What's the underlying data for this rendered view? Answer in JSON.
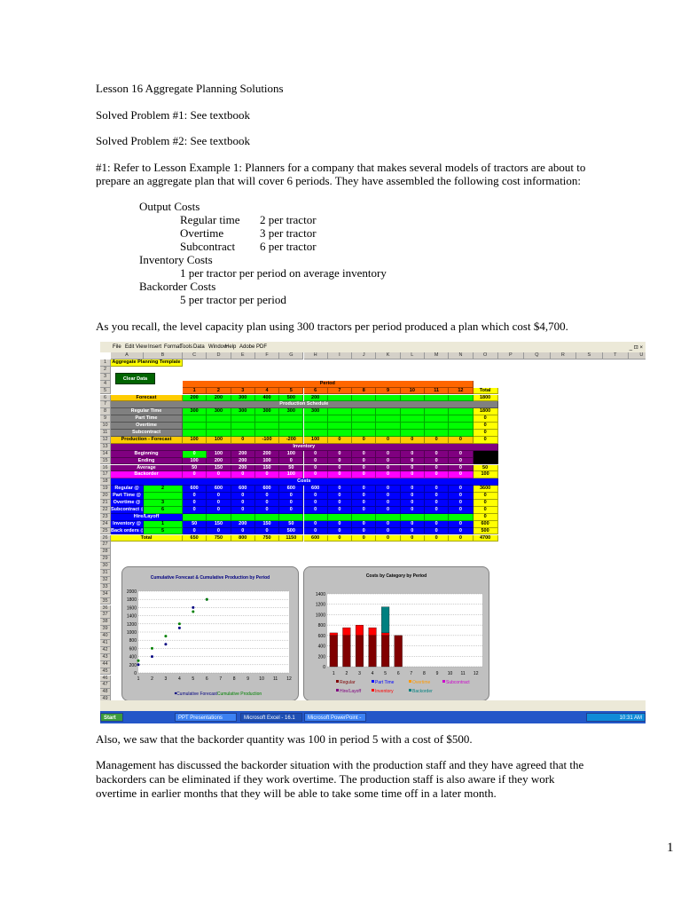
{
  "doc": {
    "title": "Lesson 16 Aggregate Planning Solutions",
    "sp1": "Solved Problem #1: See textbook",
    "sp2": "Solved Problem #2: See textbook",
    "p1a": "#1:  Refer to Lesson Example 1: Planners for a company that makes several models of tractors are about to",
    "p1b": "prepare an aggregate plan that will cover 6 periods.  They have assembled the following cost information:",
    "output_costs": "Output Costs",
    "regular_time": "Regular time",
    "regular_cost": "2 per tractor",
    "overtime": "Overtime",
    "overtime_cost": "3 per tractor",
    "subcontract": "Subcontract",
    "subcontract_cost": "6 per tractor",
    "inventory_costs": "Inventory Costs",
    "inventory_desc": "1 per tractor per period on average inventory",
    "backorder_costs": "Backorder Costs",
    "backorder_desc": "5 per tractor per period",
    "recall": "As you recall, the level capacity plan using 300 tractors per period produced a plan which cost $4,700.",
    "also": "Also, we saw that the backorder quantity was 100 in period 5 with a cost of $500.",
    "mgmt1": "Management has discussed the backorder situation with the production staff and they have agreed that the",
    "mgmt2": "backorders can be eliminated if they work overtime.  The production staff is also aware if they work",
    "mgmt3": "overtime in earlier months that they will be able to take some time off in a later month.",
    "page_number": "1"
  },
  "excel": {
    "menu": [
      "File",
      "Edit",
      "View",
      "Insert",
      "Format",
      "Tools",
      "Data",
      "Window",
      "Help",
      "Adobe PDF"
    ],
    "window_controls": "_ ⊡ ×",
    "columns": [
      "A",
      "B",
      "C",
      "D",
      "E",
      "F",
      "G",
      "H",
      "I",
      "J",
      "K",
      "L",
      "M",
      "N",
      "O",
      "P",
      "Q",
      "R",
      "S",
      "T",
      "U"
    ],
    "a1": "Aggregate Planning Template",
    "clear_button": "Clear Data",
    "period_label": "Period",
    "periods": [
      "1",
      "2",
      "3",
      "4",
      "5",
      "6",
      "7",
      "8",
      "9",
      "10",
      "11",
      "12"
    ],
    "total_label": "Total",
    "production_schedule_label": "Production Schedule",
    "inventory_label": "Inventory",
    "costs_label": "Costs",
    "colors": {
      "orange": "#ff6600",
      "green": "#00ff00",
      "gold": "#ffcc00",
      "gray": "#808080",
      "purple": "#800080",
      "magenta": "#ff00ff",
      "blue": "#0000ff",
      "yellow": "#ffff00",
      "black": "#000000"
    },
    "rows": [
      {
        "row": 6,
        "label": "Forecast",
        "values": [
          "200",
          "200",
          "300",
          "400",
          "500",
          "200",
          "",
          "",
          "",
          "",
          "",
          ""
        ],
        "total": "1800",
        "kind": "forecast"
      },
      {
        "row": 8,
        "label": "Regular Time",
        "values": [
          "300",
          "300",
          "300",
          "300",
          "300",
          "300",
          "",
          "",
          "",
          "",
          "",
          ""
        ],
        "total": "1800",
        "kind": "sched"
      },
      {
        "row": 9,
        "label": "Part Time",
        "values": [
          "",
          "",
          "",
          "",
          "",
          "",
          "",
          "",
          "",
          "",
          "",
          ""
        ],
        "total": "0",
        "kind": "sched"
      },
      {
        "row": 10,
        "label": "Overtime",
        "values": [
          "",
          "",
          "",
          "",
          "",
          "",
          "",
          "",
          "",
          "",
          "",
          ""
        ],
        "total": "0",
        "kind": "sched"
      },
      {
        "row": 11,
        "label": "Subcontract",
        "values": [
          "",
          "",
          "",
          "",
          "",
          "",
          "",
          "",
          "",
          "",
          "",
          ""
        ],
        "total": "0",
        "kind": "sched"
      },
      {
        "row": 12,
        "label": "Production - Forecast",
        "values": [
          "100",
          "100",
          "0",
          "-100",
          "-200",
          "100",
          "0",
          "0",
          "0",
          "0",
          "0",
          "0"
        ],
        "total": "0",
        "kind": "diff"
      },
      {
        "row": 14,
        "label": "Beginning",
        "values": [
          "0",
          "100",
          "200",
          "200",
          "100",
          "0",
          "0",
          "0",
          "0",
          "0",
          "0",
          "0"
        ],
        "total": "",
        "kind": "inv_begin"
      },
      {
        "row": 15,
        "label": "Ending",
        "values": [
          "100",
          "200",
          "200",
          "100",
          "0",
          "0",
          "0",
          "0",
          "0",
          "0",
          "0",
          "0"
        ],
        "total": "",
        "kind": "inv_end"
      },
      {
        "row": 16,
        "label": "Average",
        "values": [
          "50",
          "150",
          "200",
          "150",
          "50",
          "0",
          "0",
          "0",
          "0",
          "0",
          "0",
          "0"
        ],
        "total": "50",
        "kind": "inv"
      },
      {
        "row": 17,
        "label": "Backorder",
        "values": [
          "0",
          "0",
          "0",
          "0",
          "100",
          "0",
          "0",
          "0",
          "0",
          "0",
          "0",
          "0"
        ],
        "total": "100",
        "kind": "backorder"
      },
      {
        "row": 19,
        "label": "Regular @",
        "rate": "2",
        "values": [
          "600",
          "600",
          "600",
          "600",
          "600",
          "600",
          "0",
          "0",
          "0",
          "0",
          "0",
          "0"
        ],
        "total": "3600",
        "kind": "cost"
      },
      {
        "row": 20,
        "label": "Part Time @",
        "rate": "",
        "values": [
          "0",
          "0",
          "0",
          "0",
          "0",
          "0",
          "0",
          "0",
          "0",
          "0",
          "0",
          "0"
        ],
        "total": "0",
        "kind": "cost"
      },
      {
        "row": 21,
        "label": "Overtime @",
        "rate": "3",
        "values": [
          "0",
          "0",
          "0",
          "0",
          "0",
          "0",
          "0",
          "0",
          "0",
          "0",
          "0",
          "0"
        ],
        "total": "0",
        "kind": "cost"
      },
      {
        "row": 22,
        "label": "Subcontract @",
        "rate": "6",
        "values": [
          "0",
          "0",
          "0",
          "0",
          "0",
          "0",
          "0",
          "0",
          "0",
          "0",
          "0",
          "0"
        ],
        "total": "0",
        "kind": "cost"
      },
      {
        "row": 23,
        "label": "Hire/Layoff",
        "values": [
          "",
          "",
          "",
          "",
          "",
          "",
          "",
          "",
          "",
          "",
          "",
          ""
        ],
        "total": "0",
        "kind": "hire"
      },
      {
        "row": 24,
        "label": "Inventory @",
        "rate": "1",
        "values": [
          "50",
          "150",
          "200",
          "150",
          "50",
          "0",
          "0",
          "0",
          "0",
          "0",
          "0",
          "0"
        ],
        "total": "600",
        "kind": "cost"
      },
      {
        "row": 25,
        "label": "Back orders @",
        "rate": "5",
        "values": [
          "0",
          "0",
          "0",
          "0",
          "500",
          "0",
          "0",
          "0",
          "0",
          "0",
          "0",
          "0"
        ],
        "total": "500",
        "kind": "cost"
      },
      {
        "row": 26,
        "label": "Total",
        "values": [
          "650",
          "750",
          "800",
          "750",
          "1150",
          "600",
          "0",
          "0",
          "0",
          "0",
          "0",
          "0"
        ],
        "total": "4700",
        "kind": "total"
      }
    ],
    "taskbar": {
      "start": "Start",
      "items": [
        "PPT Presentations",
        "Microsoft Excel - 16.1 ...",
        "Microsoft PowerPoint - [..."
      ],
      "clock": "10:31 AM"
    }
  },
  "chart_data": [
    {
      "type": "scatter",
      "title": "Cumulative Forecast & Cumulative Production by Period",
      "x": [
        1,
        2,
        3,
        4,
        5,
        6
      ],
      "series": [
        {
          "name": "Cumulative Forecast",
          "color": "#000080",
          "values": [
            200,
            400,
            700,
            1100,
            1600,
            1800
          ]
        },
        {
          "name": "Cumulative Production",
          "color": "#008000",
          "values": [
            300,
            600,
            900,
            1200,
            1500,
            1800
          ]
        }
      ],
      "xlim": [
        1,
        12
      ],
      "xticks": [
        1,
        2,
        3,
        4,
        5,
        6,
        7,
        8,
        9,
        10,
        11,
        12
      ],
      "ylim": [
        0,
        2000
      ],
      "yticks": [
        0,
        200,
        400,
        600,
        800,
        1000,
        1200,
        1400,
        1600,
        1800,
        2000
      ],
      "grid": true,
      "legend": "bottom"
    },
    {
      "type": "bar",
      "stacked": true,
      "title": "Costs by Category by Period",
      "categories": [
        "1",
        "2",
        "3",
        "4",
        "5",
        "6",
        "7",
        "8",
        "9",
        "10",
        "11",
        "12"
      ],
      "series": [
        {
          "name": "Regular",
          "color": "#800000",
          "values": [
            600,
            600,
            600,
            600,
            600,
            600,
            0,
            0,
            0,
            0,
            0,
            0
          ]
        },
        {
          "name": "Part Time",
          "color": "#0000ff",
          "values": [
            0,
            0,
            0,
            0,
            0,
            0,
            0,
            0,
            0,
            0,
            0,
            0
          ]
        },
        {
          "name": "Overtime",
          "color": "#ff9900",
          "values": [
            0,
            0,
            0,
            0,
            0,
            0,
            0,
            0,
            0,
            0,
            0,
            0
          ]
        },
        {
          "name": "Subcontract",
          "color": "#cc00cc",
          "values": [
            0,
            0,
            0,
            0,
            0,
            0,
            0,
            0,
            0,
            0,
            0,
            0
          ]
        },
        {
          "name": "Hire/Layoff",
          "color": "#800080",
          "values": [
            0,
            0,
            0,
            0,
            0,
            0,
            0,
            0,
            0,
            0,
            0,
            0
          ]
        },
        {
          "name": "Inventory",
          "color": "#ff0000",
          "values": [
            50,
            150,
            200,
            150,
            50,
            0,
            0,
            0,
            0,
            0,
            0,
            0
          ]
        },
        {
          "name": "Backorder",
          "color": "#008080",
          "values": [
            0,
            0,
            0,
            0,
            500,
            0,
            0,
            0,
            0,
            0,
            0,
            0
          ]
        }
      ],
      "ylim": [
        0,
        1400
      ],
      "yticks": [
        0,
        200,
        400,
        600,
        800,
        1000,
        1200,
        1400
      ],
      "grid": true,
      "legend": "bottom"
    }
  ]
}
